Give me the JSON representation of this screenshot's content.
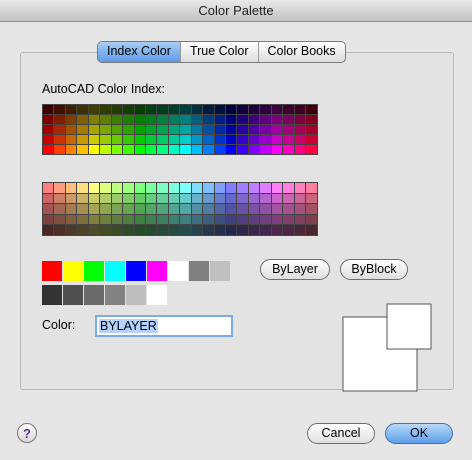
{
  "window": {
    "title": "Color Palette"
  },
  "tabs": [
    {
      "label": "Index Color",
      "active": true
    },
    {
      "label": "True Color",
      "active": false
    },
    {
      "label": "Color Books",
      "active": false
    }
  ],
  "index_panel": {
    "label": "AutoCAD Color Index:",
    "bright_grid": {
      "rows": [
        [
          "#3f0000",
          "#3f1000",
          "#3f1f00",
          "#3f2f00",
          "#3f3f00",
          "#2f3f00",
          "#1f3f00",
          "#103f00",
          "#003f00",
          "#003f10",
          "#003f1f",
          "#003f2f",
          "#003f3f",
          "#002f3f",
          "#001f3f",
          "#00103f",
          "#00003f",
          "#10003f",
          "#1f003f",
          "#2f003f",
          "#3f003f",
          "#3f002f",
          "#3f001f",
          "#3f0010"
        ],
        [
          "#7f0000",
          "#7f1f00",
          "#7f3f00",
          "#7f5f00",
          "#7f7f00",
          "#5f7f00",
          "#3f7f00",
          "#1f7f00",
          "#007f00",
          "#007f1f",
          "#007f3f",
          "#007f5f",
          "#007f7f",
          "#005f7f",
          "#003f7f",
          "#001f7f",
          "#00007f",
          "#1f007f",
          "#3f007f",
          "#5f007f",
          "#7f007f",
          "#7f005f",
          "#7f003f",
          "#7f001f"
        ],
        [
          "#a50000",
          "#a52900",
          "#a55200",
          "#a57b00",
          "#a5a500",
          "#7ba500",
          "#52a500",
          "#29a500",
          "#00a500",
          "#00a529",
          "#00a552",
          "#00a57b",
          "#00a5a5",
          "#007ba5",
          "#0052a5",
          "#0029a5",
          "#0000a5",
          "#2900a5",
          "#5200a5",
          "#7b00a5",
          "#a500a5",
          "#a5007b",
          "#a50052",
          "#a50029"
        ],
        [
          "#cc0000",
          "#cc3300",
          "#cc6600",
          "#cc9900",
          "#cccc00",
          "#99cc00",
          "#66cc00",
          "#33cc00",
          "#00cc00",
          "#00cc33",
          "#00cc66",
          "#00cc99",
          "#00cccc",
          "#0099cc",
          "#0066cc",
          "#0033cc",
          "#0000cc",
          "#3300cc",
          "#6600cc",
          "#9900cc",
          "#cc00cc",
          "#cc0099",
          "#cc0066",
          "#cc0033"
        ],
        [
          "#ff0000",
          "#ff4000",
          "#ff8000",
          "#ffbf00",
          "#ffff00",
          "#bfff00",
          "#80ff00",
          "#40ff00",
          "#00ff00",
          "#00ff40",
          "#00ff80",
          "#00ffbf",
          "#00ffff",
          "#00bfff",
          "#0080ff",
          "#0040ff",
          "#0000ff",
          "#4000ff",
          "#8000ff",
          "#bf00ff",
          "#ff00ff",
          "#ff00bf",
          "#ff0080",
          "#ff0040"
        ]
      ]
    },
    "pastel_grid": {
      "rows": [
        [
          "#ff7f7f",
          "#ff9f7f",
          "#ffbf7f",
          "#ffdf7f",
          "#ffff7f",
          "#dfff7f",
          "#bfff7f",
          "#9fff7f",
          "#7fff7f",
          "#7fff9f",
          "#7fffbf",
          "#7fffdf",
          "#7fffff",
          "#7fdfff",
          "#7fbfff",
          "#7f9fff",
          "#7f7fff",
          "#9f7fff",
          "#bf7fff",
          "#df7fff",
          "#ff7fff",
          "#ff7fdf",
          "#ff7fbf",
          "#ff7f9f"
        ],
        [
          "#cc6666",
          "#cc7f66",
          "#cc9966",
          "#ccb266",
          "#cccc66",
          "#b2cc66",
          "#99cc66",
          "#7fcc66",
          "#66cc66",
          "#66cc7f",
          "#66cc99",
          "#66ccb2",
          "#66cccc",
          "#66b2cc",
          "#6699cc",
          "#667fcc",
          "#6666cc",
          "#7f66cc",
          "#9966cc",
          "#b266cc",
          "#cc66cc",
          "#cc66b2",
          "#cc6699",
          "#cc667f"
        ],
        [
          "#a55252",
          "#a56752",
          "#a57b52",
          "#a59052",
          "#a5a552",
          "#90a552",
          "#7ba552",
          "#67a552",
          "#52a552",
          "#52a567",
          "#52a57b",
          "#52a590",
          "#52a5a5",
          "#5290a5",
          "#527ba5",
          "#5267a5",
          "#5252a5",
          "#6752a5",
          "#7b52a5",
          "#9052a5",
          "#a552a5",
          "#a55290",
          "#a5527b",
          "#a55267"
        ],
        [
          "#7f3f3f",
          "#7f4f3f",
          "#7f5f3f",
          "#7f6f3f",
          "#7f7f3f",
          "#6f7f3f",
          "#5f7f3f",
          "#4f7f3f",
          "#3f7f3f",
          "#3f7f4f",
          "#3f7f5f",
          "#3f7f6f",
          "#3f7f7f",
          "#3f6f7f",
          "#3f5f7f",
          "#3f4f7f",
          "#3f3f7f",
          "#4f3f7f",
          "#5f3f7f",
          "#6f3f7f",
          "#7f3f7f",
          "#7f3f6f",
          "#7f3f5f",
          "#7f3f4f"
        ],
        [
          "#4c2626",
          "#4c2f26",
          "#4c3926",
          "#4c4226",
          "#4c4c26",
          "#424c26",
          "#394c26",
          "#2f4c26",
          "#264c26",
          "#264c2f",
          "#264c39",
          "#264c42",
          "#264c4c",
          "#26424c",
          "#26394c",
          "#262f4c",
          "#26264c",
          "#2f264c",
          "#39264c",
          "#42264c",
          "#4c264c",
          "#4c2642",
          "#4c2639",
          "#4c262f"
        ]
      ]
    },
    "basic_colors": [
      "#ff0000",
      "#ffff00",
      "#00ff00",
      "#00ffff",
      "#0000ff",
      "#ff00ff",
      "#ffffff",
      "#808080",
      "#c0c0c0"
    ],
    "gray_colors": [
      "#333333",
      "#505050",
      "#696969",
      "#828282",
      "#bebebe",
      "#ffffff"
    ],
    "bylayer_label": "ByLayer",
    "byblock_label": "ByBlock"
  },
  "color_field": {
    "label": "Color:",
    "value": "BYLAYER"
  },
  "buttons": {
    "cancel": "Cancel",
    "ok": "OK",
    "help": "?"
  }
}
